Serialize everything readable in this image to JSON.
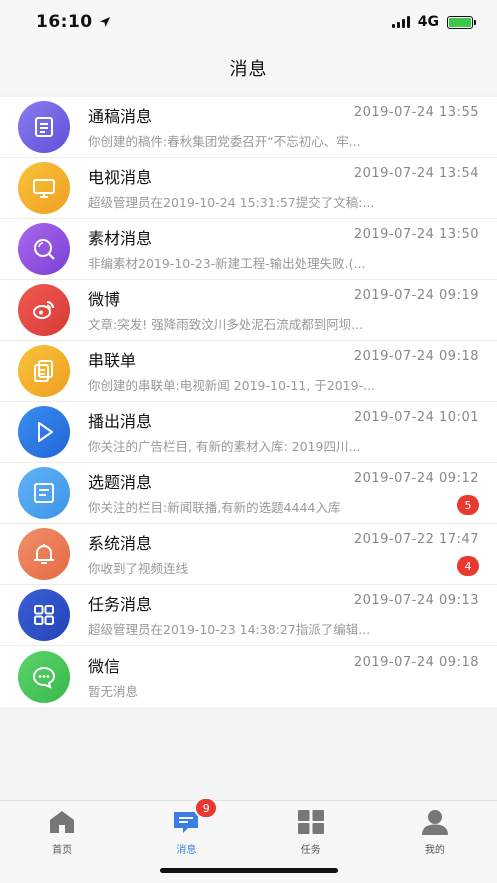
{
  "status_bar": {
    "time": "16:10",
    "network": "4G"
  },
  "nav": {
    "title": "消息"
  },
  "messages": [
    {
      "title": "通稿消息",
      "time": "2019-07-24 13:55",
      "preview": "你创建的稿件:春秋集团党委召开“不忘初心、牢...",
      "icon": "document-icon",
      "color_from": "#8a7cf0",
      "color_to": "#5f4fd8",
      "badge": ""
    },
    {
      "title": "电视消息",
      "time": "2019-07-24 13:54",
      "preview": "超级管理员在2019-10-24 15:31:57提交了文稿:...",
      "icon": "tv-icon",
      "color_from": "#f8c23c",
      "color_to": "#f0a020",
      "badge": ""
    },
    {
      "title": "素材消息",
      "time": "2019-07-24 13:50",
      "preview": "非编素材2019-10-23-新建工程-输出处理失败.(...",
      "icon": "search-icon",
      "color_from": "#a769ea",
      "color_to": "#7d3fd6",
      "badge": ""
    },
    {
      "title": "微博",
      "time": "2019-07-24 09:19",
      "preview": "文章:突发! 强降雨致汶川多处泥石流成都到阿坝...",
      "icon": "weibo-icon",
      "color_from": "#ee5a52",
      "color_to": "#d83a34",
      "badge": ""
    },
    {
      "title": "串联单",
      "time": "2019-07-24 09:18",
      "preview": "你创建的串联单:电视新闻 2019-10-11, 于2019-...",
      "icon": "copy-icon",
      "color_from": "#f8c23c",
      "color_to": "#f0a020",
      "badge": ""
    },
    {
      "title": "播出消息",
      "time": "2019-07-24 10:01",
      "preview": "你关注的广告栏目, 有新的素材入库: 2019四川...",
      "icon": "play-icon",
      "color_from": "#3a8df0",
      "color_to": "#2266d8",
      "badge": ""
    },
    {
      "title": "选题消息",
      "time": "2019-07-24 09:12",
      "preview": "你关注的栏目:新闻联播,有新的选题4444入库",
      "icon": "list-icon",
      "color_from": "#5fb3f5",
      "color_to": "#3e95e8",
      "badge": "5"
    },
    {
      "title": "系统消息",
      "time": "2019-07-22 17:47",
      "preview": "你收到了视频连线",
      "icon": "bell-icon",
      "color_from": "#f18f6a",
      "color_to": "#e46b45",
      "badge": "4"
    },
    {
      "title": "任务消息",
      "time": "2019-07-24 09:13",
      "preview": "超级管理员在2019-10-23 14:38:27指派了编辑...",
      "icon": "grid-icon",
      "color_from": "#3b5fd6",
      "color_to": "#2444b8",
      "badge": ""
    },
    {
      "title": "微信",
      "time": "2019-07-24 09:18",
      "preview": "暂无消息",
      "icon": "wechat-icon",
      "color_from": "#5cd46c",
      "color_to": "#38b84a",
      "badge": ""
    }
  ],
  "tabs": [
    {
      "label": "首页",
      "icon": "home-icon",
      "active": false,
      "badge": ""
    },
    {
      "label": "消息",
      "icon": "message-icon",
      "active": true,
      "badge": "9"
    },
    {
      "label": "任务",
      "icon": "grid-icon",
      "active": false,
      "badge": ""
    },
    {
      "label": "我的",
      "icon": "user-icon",
      "active": false,
      "badge": ""
    }
  ],
  "colors": {
    "accent": "#3b7de0",
    "badge": "#e8392f",
    "tab_inactive": "#777777"
  }
}
